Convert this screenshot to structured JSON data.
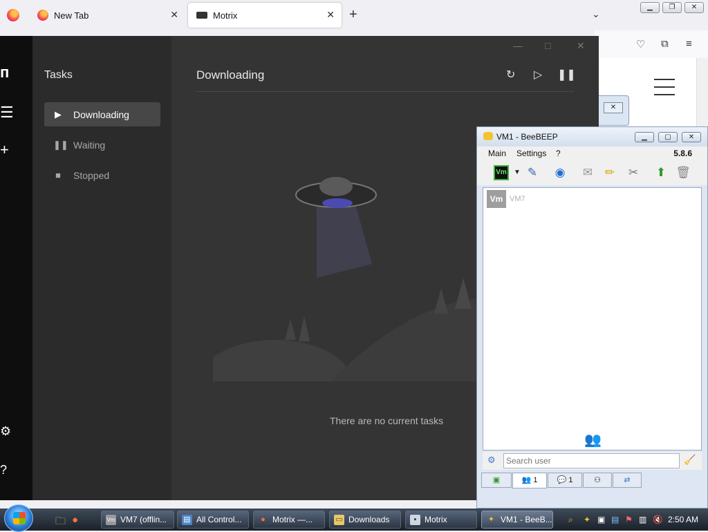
{
  "firefox": {
    "tabs": [
      {
        "label": "New Tab",
        "active": false
      },
      {
        "label": "Motrix",
        "active": true
      }
    ]
  },
  "motrix": {
    "sidebar_title": "Tasks",
    "nav": [
      {
        "label": "Downloading",
        "icon": "play-icon",
        "active": true
      },
      {
        "label": "Waiting",
        "icon": "pause-icon",
        "active": false
      },
      {
        "label": "Stopped",
        "icon": "stop-icon",
        "active": false
      }
    ],
    "header": "Downloading",
    "empty_message": "There are no current tasks"
  },
  "beebeep": {
    "title": "VM1 - BeeBEEP",
    "menu": [
      "Main",
      "Settings",
      "?"
    ],
    "version": "5.8.6",
    "user_badge": "Vm",
    "users": [
      {
        "avatar": "Vm",
        "name": "VM7"
      }
    ],
    "search_placeholder": "Search user",
    "tabs": [
      {
        "label": "",
        "icon": "monitor-icon"
      },
      {
        "label": "1",
        "icon": "users-icon"
      },
      {
        "label": "1",
        "icon": "chat-icon"
      },
      {
        "label": "",
        "icon": "groups-icon"
      },
      {
        "label": "",
        "icon": "share-icon"
      }
    ]
  },
  "taskbar": {
    "buttons": [
      {
        "label": "VM7 (offlin...",
        "icon": "vm-icon"
      },
      {
        "label": "All Control...",
        "icon": "control-panel-icon"
      },
      {
        "label": "Motrix —...",
        "icon": "firefox-icon"
      },
      {
        "label": "Downloads",
        "icon": "folder-icon"
      },
      {
        "label": "Motrix",
        "icon": "motrix-icon"
      },
      {
        "label": "VM1 - BeeB...",
        "icon": "beebeep-icon"
      }
    ],
    "clock": "2:50 AM"
  }
}
